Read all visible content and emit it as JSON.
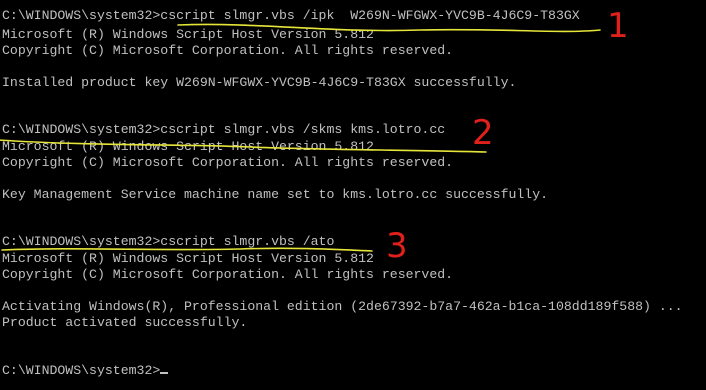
{
  "console": {
    "lines": [
      "C:\\WINDOWS\\system32>cscript slmgr.vbs /ipk  W269N-WFGWX-YVC9B-4J6C9-T83GX",
      "Microsoft (R) Windows Script Host Version 5.812",
      "Copyright (C) Microsoft Corporation. All rights reserved.",
      "",
      "Installed product key W269N-WFGWX-YVC9B-4J6C9-T83GX successfully.",
      "",
      "",
      "C:\\WINDOWS\\system32>cscript slmgr.vbs /skms kms.lotro.cc",
      "Microsoft (R) Windows Script Host Version 5.812",
      "Copyright (C) Microsoft Corporation. All rights reserved.",
      "",
      "Key Management Service machine name set to kms.lotro.cc successfully.",
      "",
      "",
      "C:\\WINDOWS\\system32>cscript slmgr.vbs /ato",
      "Microsoft (R) Windows Script Host Version 5.812",
      "Copyright (C) Microsoft Corporation. All rights reserved.",
      "",
      "Activating Windows(R), Professional edition (2de67392-b7a7-462a-b1ca-108dd189f588) ...",
      "Product activated successfully.",
      "",
      "",
      "C:\\WINDOWS\\system32>"
    ]
  },
  "annotations": {
    "step1": "1",
    "step2": "2",
    "step3": "3",
    "ink_color": "#e0201b",
    "underline_color": "#e6e63a"
  },
  "colors": {
    "background": "#000000",
    "text": "#c0c0c0"
  }
}
